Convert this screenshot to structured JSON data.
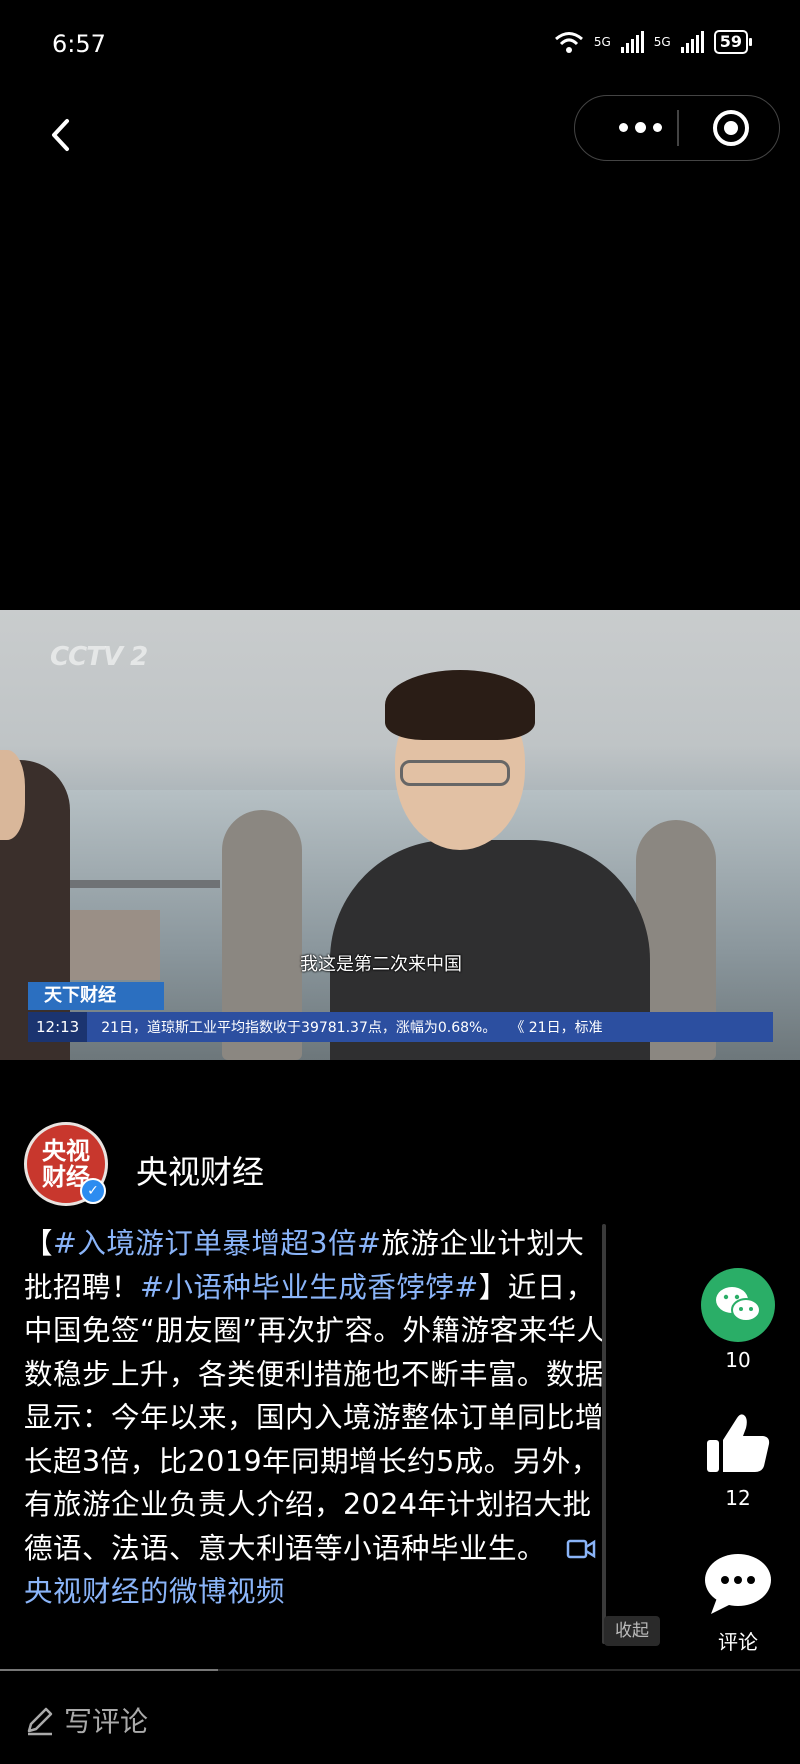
{
  "status_bar": {
    "time": "6:57",
    "network1": "5G",
    "network2": "5G",
    "battery": "59"
  },
  "video": {
    "channel_logo": "CCTV 2",
    "subtitle": "我这是第二次来中国",
    "program_tag": "天下财经",
    "ticker_time": "12:13",
    "ticker_text": "21日，道琼斯工业平均指数收于39781.37点，涨幅为0.68%。　　《 21日，标准"
  },
  "author": {
    "avatar_text": "央视财经",
    "name": "央视财经"
  },
  "post": {
    "bracket_open": "【",
    "hashtag1": "#入境游订单暴增超3倍#",
    "text1": "旅游企业计划大批招聘！",
    "hashtag2": "#小语种毕业生成香饽饽#",
    "text2": "】近日，中国免签“朋友圈”再次扩容。外籍游客来华人数稳步上升，各类便利措施也不断丰富。数据显示：今年以来，国内入境游整体订单同比增长超3倍，比2019年同期增长约5成。另外，有旅游企业负责人介绍，2024年计划招大批德语、法语、意大利语等小语种毕业生。",
    "video_link": "央视财经的微博视频",
    "collapse_label": "收起"
  },
  "actions": {
    "share_count": "10",
    "like_count": "12",
    "comment_label": "评论"
  },
  "bottom": {
    "write_comment": "写评论"
  },
  "colors": {
    "background": "#000000",
    "link": "#8ab4f8",
    "wechat_green": "#2aae67"
  }
}
